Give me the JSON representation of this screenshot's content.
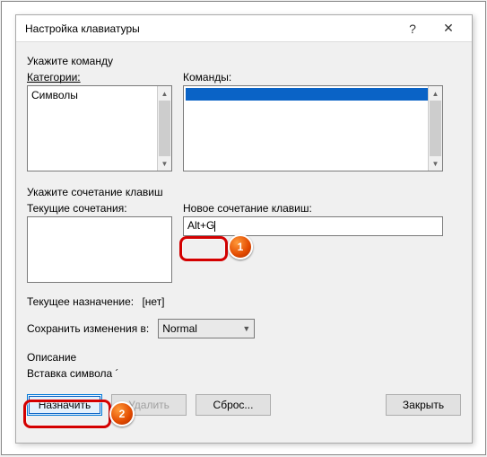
{
  "dialog": {
    "title": "Настройка клавиатуры"
  },
  "section1": {
    "label": "Укажите команду",
    "categories_label": "Категории:",
    "categories_item": "Символы",
    "commands_label": "Команды:",
    "commands_item": ""
  },
  "section2": {
    "label": "Укажите сочетание клавиш",
    "current_label": "Текущие сочетания:",
    "new_label": "Новое сочетание клавиш:",
    "new_value": "Alt+G"
  },
  "assignment": {
    "label": "Текущее назначение:",
    "value": "[нет]"
  },
  "savein": {
    "label": "Сохранить изменения в:",
    "value": "Normal"
  },
  "description": {
    "label": "Описание",
    "text": "Вставка символа ´"
  },
  "buttons": {
    "assign": "Назначить",
    "remove": "Удалить",
    "reset": "Сброс...",
    "close": "Закрыть"
  },
  "annotations": {
    "badge1": "1",
    "badge2": "2"
  }
}
